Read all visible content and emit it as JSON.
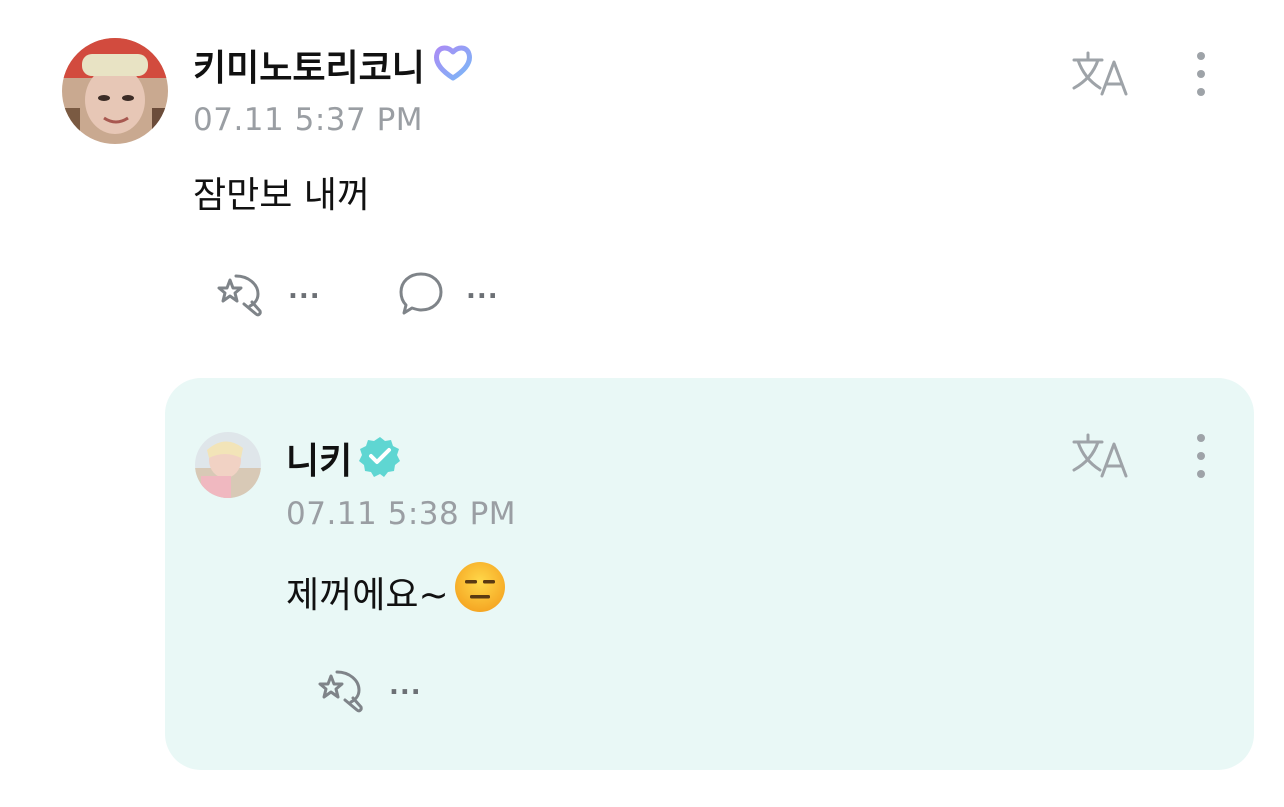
{
  "post": {
    "author": "키미노토리코니",
    "badge_icon": "heart-ring-icon",
    "timestamp": "07.11 5:37 PM",
    "text": "잠만보 내꺼",
    "like_count": "...",
    "comment_count": "..."
  },
  "reply": {
    "author": "니키",
    "badge_icon": "verified-check-icon",
    "timestamp": "07.11 5:38 PM",
    "text": "제꺼에요~",
    "emoji_icon": "expressionless-face-emoji",
    "like_count": "..."
  },
  "colors": {
    "reply_background": "#e9f8f6",
    "verified_badge": "#5fd6d2",
    "timestamp": "#9a9ea3",
    "icon_gray": "#9ea3a8"
  }
}
